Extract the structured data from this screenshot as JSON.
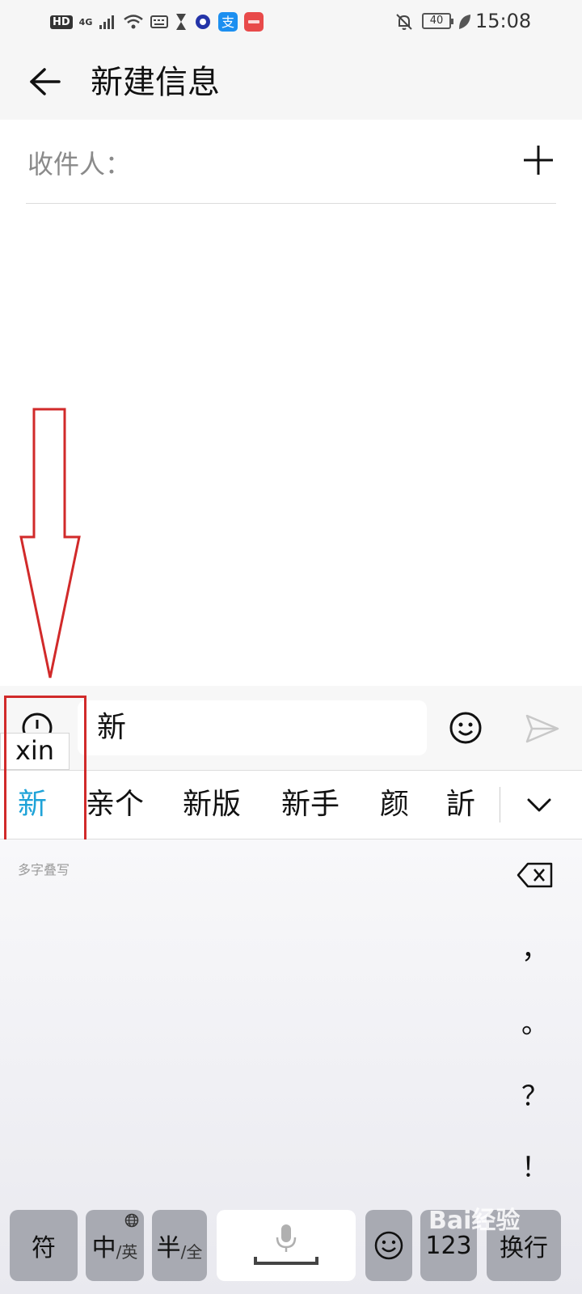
{
  "status_bar": {
    "hd": "HD",
    "network": "4G",
    "battery": "40",
    "time": "15:08"
  },
  "app_bar": {
    "title": "新建信息"
  },
  "recipient": {
    "label": "收件人："
  },
  "compose": {
    "input_value": "新",
    "pinyin": "xin"
  },
  "candidates": [
    "新",
    "亲个",
    "新版",
    "新手",
    "颜",
    "訢"
  ],
  "keyboard": {
    "hint": "多字叠写",
    "side_keys": [
      "，",
      "。",
      "？",
      "！"
    ],
    "symbol_key": "符",
    "cn_key": "中",
    "cn_key_sub": "/英",
    "half_key": "半",
    "half_key_sub": "/全",
    "num_key": "123",
    "enter_key": "换行"
  },
  "watermark": "Bai经验"
}
